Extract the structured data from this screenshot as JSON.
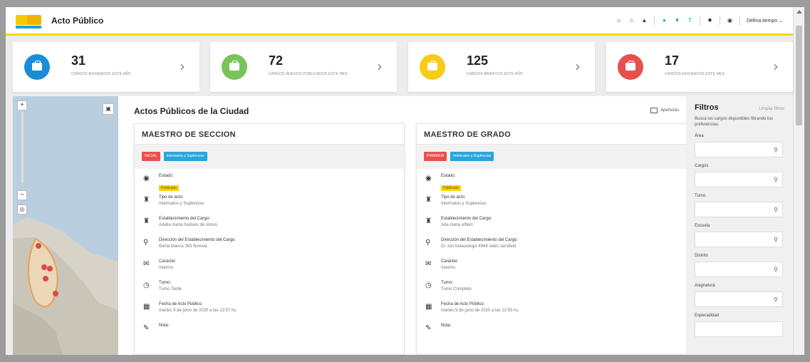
{
  "header": {
    "title": "Acto Público",
    "user": "Defina tiempo"
  },
  "colors": {
    "accent_yellow": "#f5d90a",
    "blue": "#1aa3d9",
    "green": "#7ac35a",
    "yellow": "#f7cb17",
    "red": "#e8504c"
  },
  "stats": [
    {
      "value": "31",
      "caption": "CARGOS ASIGNADOS ESTE AÑO",
      "color": "#1a8cd8"
    },
    {
      "value": "72",
      "caption": "CARGOS NUEVOS PUBLICADOS ESTE MES",
      "color": "#7ac35a"
    },
    {
      "value": "125",
      "caption": "CARGOS ABIERTOS ESTE AÑO",
      "color": "#f7cb17"
    },
    {
      "value": "17",
      "caption": "CARGOS ASIGNADOS ESTE MES",
      "color": "#e8504c"
    }
  ],
  "list": {
    "heading": "Actos Públicos de la Ciudad",
    "aperturas": "Aperturas"
  },
  "cards": [
    {
      "title": "MAESTRO DE SECCION",
      "tag1": "INICIAL",
      "tag2": "Interinatos y Suplencias",
      "estado_label": "Estado:",
      "estado": "Publicado",
      "tipo_label": "Tipo de acto:",
      "tipo": "Interinatos y Suplencias",
      "est_label": "Establecimiento del Cargo:",
      "est": "Adelia maria harilaos de olmos",
      "dir_label": "Dirección del Establecimiento del Cargo:",
      "dir": "Bahia blanca 363 floresta",
      "car_label": "Carácter:",
      "car": "Interino",
      "turno_label": "Turno:",
      "turno": "Turno Tarde",
      "fecha_label": "Fecha de Acto Público:",
      "fecha": "martes 9 de junio de 2020 a las 12:57 hs.",
      "nota_label": "Nota:"
    },
    {
      "title": "MAESTRO DE GRADO",
      "tag1": "PRIMARIA",
      "tag2": "Interinatos y Suplencias",
      "estado_label": "Estado:",
      "estado": "Publicado",
      "tipo_label": "Tipo de acto:",
      "tipo": "Interinatos y Suplencias",
      "est_label": "Establecimiento del Cargo:",
      "est": "Ada maria elflein",
      "dir_label": "Dirección del Establecimiento del Cargo:",
      "dir": "Dr. luis belaustegui 4949 velez sarsfield",
      "car_label": "Carácter:",
      "car": "Interino",
      "turno_label": "Turno:",
      "turno": "Turno Completo",
      "fecha_label": "Fecha de Acto Público:",
      "fecha": "martes 9 de junio de 2020 a las 12:55 hs.",
      "nota_label": "Nota:"
    }
  ],
  "filters": {
    "title": "Filtros",
    "clear": "Limpiar filtros",
    "description": "Buscá los cargos disponibles filtrando tus preferencias.",
    "fields": [
      "Área",
      "Cargos",
      "Turno",
      "Escuela",
      "Distrito",
      "Asignatura",
      "Especialidad"
    ]
  },
  "icons": {
    "home": "home-icon",
    "star": "star-icon",
    "bell": "bell-icon",
    "filter": "filter-icon",
    "search": "search-icon"
  }
}
